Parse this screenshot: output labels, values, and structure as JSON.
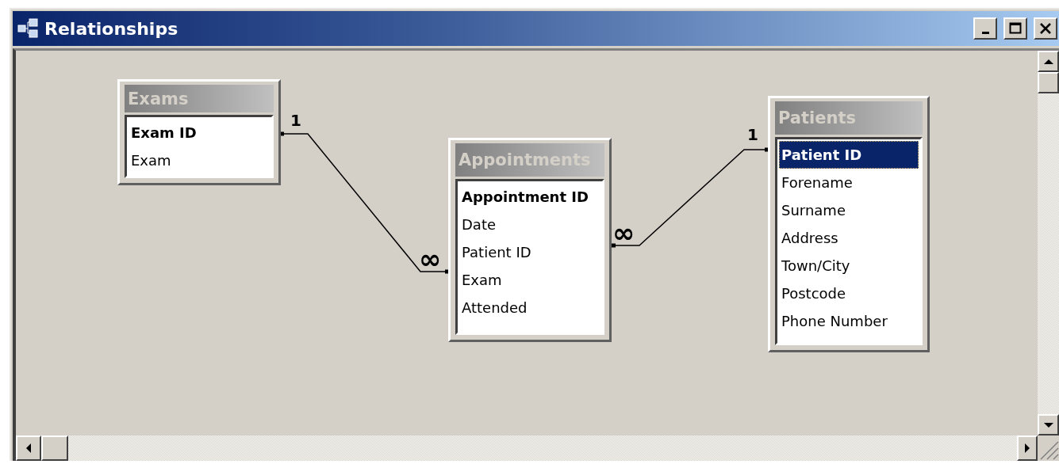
{
  "window": {
    "title": "Relationships"
  },
  "tables": [
    {
      "name": "Exams",
      "fields": [
        {
          "name": "Exam ID",
          "key": true,
          "selected": false
        },
        {
          "name": "Exam",
          "key": false,
          "selected": false
        }
      ]
    },
    {
      "name": "Appointments",
      "fields": [
        {
          "name": "Appointment ID",
          "key": true,
          "selected": false
        },
        {
          "name": "Date",
          "key": false,
          "selected": false
        },
        {
          "name": "Patient ID",
          "key": false,
          "selected": false
        },
        {
          "name": "Exam",
          "key": false,
          "selected": false
        },
        {
          "name": "Attended",
          "key": false,
          "selected": false
        }
      ]
    },
    {
      "name": "Patients",
      "fields": [
        {
          "name": "Patient ID",
          "key": true,
          "selected": true
        },
        {
          "name": "Forename",
          "key": false,
          "selected": false
        },
        {
          "name": "Surname",
          "key": false,
          "selected": false
        },
        {
          "name": "Address",
          "key": false,
          "selected": false
        },
        {
          "name": "Town/City",
          "key": false,
          "selected": false
        },
        {
          "name": "Postcode",
          "key": false,
          "selected": false
        },
        {
          "name": "Phone Number",
          "key": false,
          "selected": false
        }
      ]
    }
  ],
  "relationships": [
    {
      "one_label": "1",
      "many_label": "∞"
    },
    {
      "one_label": "1",
      "many_label": "∞"
    }
  ]
}
